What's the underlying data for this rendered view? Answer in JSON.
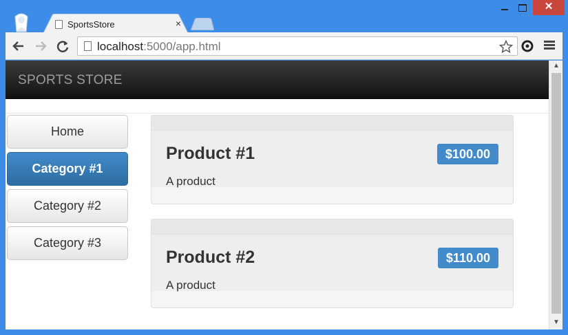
{
  "browser": {
    "tab_title": "SportsStore",
    "tab_close": "×",
    "url_host": "localhost",
    "url_rest": ":5000/app.html",
    "close_glyph": "✕"
  },
  "icons": {
    "back": "back-arrow-icon",
    "forward": "forward-arrow-icon",
    "reload": "reload-icon",
    "star": "bookmark-star-icon",
    "menu": "hamburger-menu-icon"
  },
  "app": {
    "brand": "SPORTS STORE",
    "categories": [
      {
        "label": "Home",
        "active": false
      },
      {
        "label": "Category #1",
        "active": true
      },
      {
        "label": "Category #2",
        "active": false
      },
      {
        "label": "Category #3",
        "active": false
      }
    ],
    "products": [
      {
        "name": "Product #1",
        "price": "$100.00",
        "description": "A product"
      },
      {
        "name": "Product #2",
        "price": "$110.00",
        "description": "A product"
      }
    ]
  },
  "colors": {
    "accent": "#428bca",
    "navbar": "#222222",
    "window_frame": "#3c8ce8",
    "close_button": "#c9463d"
  }
}
